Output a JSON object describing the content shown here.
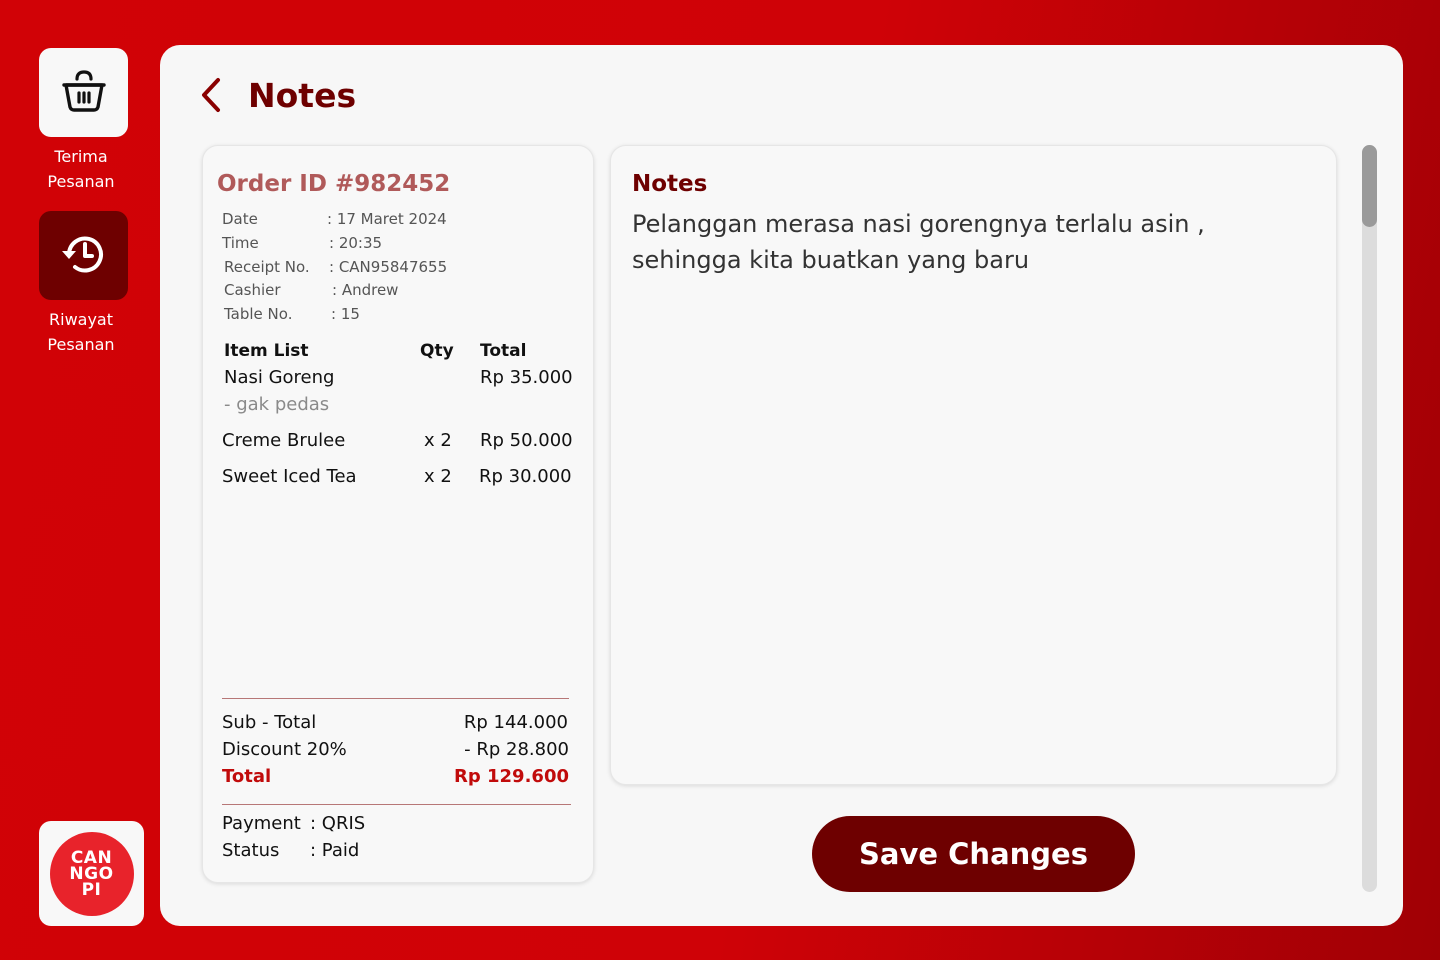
{
  "sidebar": {
    "items": [
      {
        "label_line1": "Terima",
        "label_line2": "Pesanan",
        "icon": "basket-icon",
        "active": false
      },
      {
        "label_line1": "Riwayat",
        "label_line2": "Pesanan",
        "icon": "history-icon",
        "active": true
      }
    ],
    "logo": {
      "line1": "CAN",
      "line2": "NGO",
      "line3": "PI"
    }
  },
  "header": {
    "title": "Notes"
  },
  "receipt": {
    "order_id": "Order ID #982452",
    "meta": [
      {
        "key": "Date",
        "value": ": 17 Maret 2024"
      },
      {
        "key": "Time",
        "value": ": 20:35"
      },
      {
        "key": "Receipt No.",
        "value": ": CAN95847655"
      },
      {
        "key": "Cashier",
        "value": ": Andrew"
      },
      {
        "key": "Table No.",
        "value": ": 15"
      }
    ],
    "columns": {
      "item": "Item List",
      "qty": "Qty",
      "total": "Total"
    },
    "items": [
      {
        "name": "Nasi Goreng",
        "qty": "",
        "total": "Rp 35.000",
        "note": "- gak pedas"
      },
      {
        "name": "Creme Brulee",
        "qty": "x 2",
        "total": "Rp 50.000"
      },
      {
        "name": "Sweet Iced Tea",
        "qty": "x 2",
        "total": "Rp 30.000"
      }
    ],
    "subtotal": {
      "label": "Sub - Total",
      "value": "Rp 144.000"
    },
    "discount": {
      "label": "Discount 20%",
      "value": "- Rp 28.800"
    },
    "total": {
      "label": "Total",
      "value": "Rp 129.600"
    },
    "payment": {
      "label": "Payment",
      "value": ": QRIS"
    },
    "status": {
      "label": "Status",
      "value": ": Paid"
    }
  },
  "notes": {
    "heading": "Notes",
    "line1": "Pelanggan merasa nasi gorengnya terlalu asin ,",
    "line2": "sehingga kita buatkan yang baru"
  },
  "actions": {
    "save_label": "Save Changes"
  },
  "colors": {
    "brand_red": "#d10206",
    "dark_red": "#6e0000",
    "total_red": "#c10b0b",
    "panel_bg": "#f7f7f7"
  }
}
